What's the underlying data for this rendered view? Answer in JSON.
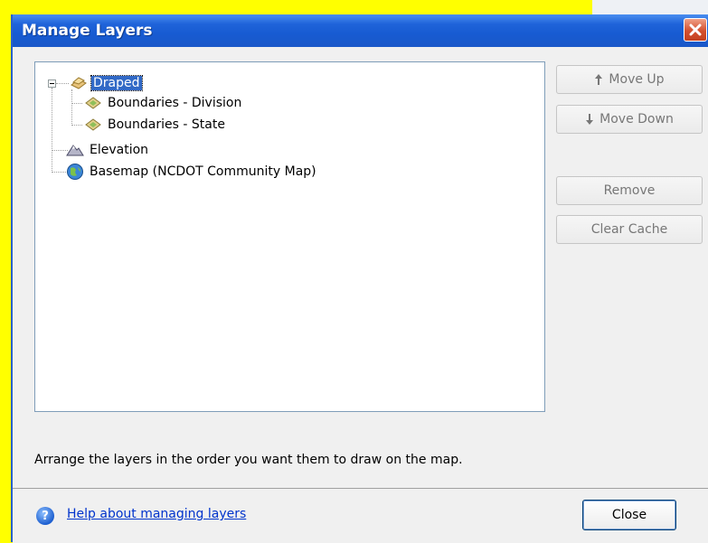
{
  "window": {
    "title": "Manage Layers"
  },
  "tree": {
    "root": {
      "label": "Draped",
      "expanded": true,
      "selected": true,
      "children": [
        {
          "label": "Boundaries - Division"
        },
        {
          "label": "Boundaries - State"
        }
      ]
    },
    "items": [
      {
        "label": "Elevation"
      },
      {
        "label": "Basemap (NCDOT Community Map)"
      }
    ]
  },
  "buttons": {
    "move_up": "Move Up",
    "move_down": "Move Down",
    "remove": "Remove",
    "clear_cache": "Clear Cache",
    "close": "Close"
  },
  "instruction": "Arrange the layers in the order you want them to draw on the map.",
  "help": {
    "link": "Help about managing layers"
  },
  "colors": {
    "titlebar": "#1f63d9",
    "selection": "#3169c6",
    "link": "#0033cc",
    "background": "#ffff00"
  }
}
